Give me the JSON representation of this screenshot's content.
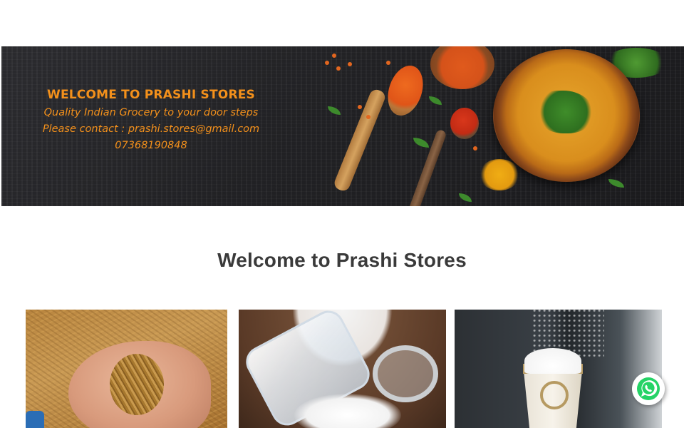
{
  "banner": {
    "title": "WELCOME TO PRASHI STORES",
    "tagline": "Quality Indian Grocery to your door steps",
    "contact_line": "Please contact : prashi.stores@gmail.com",
    "phone": "07368190848",
    "text_color": "#f3901b"
  },
  "main": {
    "heading": "Welcome to Prashi Stores"
  },
  "products": [
    {
      "image": "rice-grains-in-hand-photo"
    },
    {
      "image": "flour-jar-photo"
    },
    {
      "image": "sugar-cup-photo"
    }
  ],
  "floating": {
    "whatsapp_icon": "whatsapp-icon",
    "whatsapp_color": "#25d366"
  }
}
